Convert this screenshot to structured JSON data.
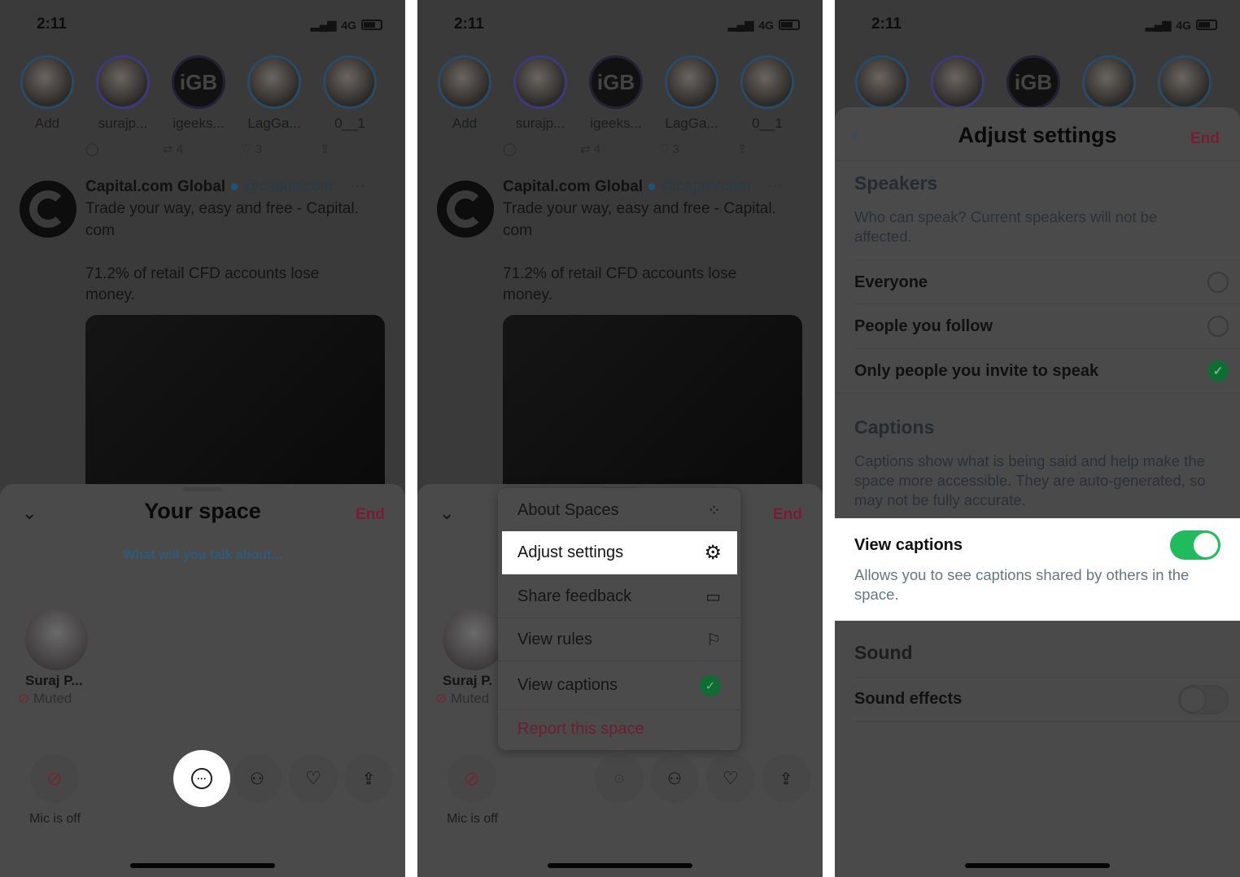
{
  "status": {
    "time": "2:11",
    "network": "4G"
  },
  "stories": [
    "Add",
    "surajp...",
    "igeeks...",
    "LagGa...",
    "0__1"
  ],
  "story_logo": "iGB",
  "tweet": {
    "retweets": "4",
    "likes": "3",
    "name": "Capital.com Global",
    "handle": "@capitalcom",
    "lines": [
      "Trade your way, easy and free - Capital.",
      "com",
      "71.2% of retail CFD accounts lose",
      "money."
    ]
  },
  "space": {
    "title": "Your space",
    "end": "End",
    "topic": "What will you talk about...",
    "speaker_panel1": "Suraj P...",
    "speaker_panel2": "Suraj P.",
    "muted": "Muted",
    "mic": "Mic is off"
  },
  "menu": {
    "items": [
      {
        "label": "About Spaces",
        "icon": "spaces-icon"
      },
      {
        "label": "Adjust settings",
        "icon": "gear-icon"
      },
      {
        "label": "Share feedback",
        "icon": "feedback-icon"
      },
      {
        "label": "View rules",
        "icon": "flag-icon"
      },
      {
        "label": "View captions",
        "icon": "check-icon"
      }
    ],
    "report": "Report this space"
  },
  "settings": {
    "title": "Adjust settings",
    "end": "End",
    "speakers_title": "Speakers",
    "speakers_desc": "Who can speak? Current speakers will not be affected.",
    "options": [
      {
        "label": "Everyone",
        "selected": false
      },
      {
        "label": "People you follow",
        "selected": false
      },
      {
        "label": "Only people you invite to speak",
        "selected": true
      }
    ],
    "captions_title": "Captions",
    "captions_desc": "Captions show what is being said and help make the space more accessible. They are auto-generated, so may not be fully accurate.",
    "view_captions": "View captions",
    "view_captions_on": true,
    "view_captions_desc": "Allows you to see captions shared by others in the space.",
    "sound_title": "Sound",
    "sound_effects": "Sound effects",
    "sound_effects_on": false
  },
  "colors": {
    "accent_red": "#e0245e",
    "toggle_green": "#1fbb5d",
    "link_blue": "#1d9bf0"
  }
}
